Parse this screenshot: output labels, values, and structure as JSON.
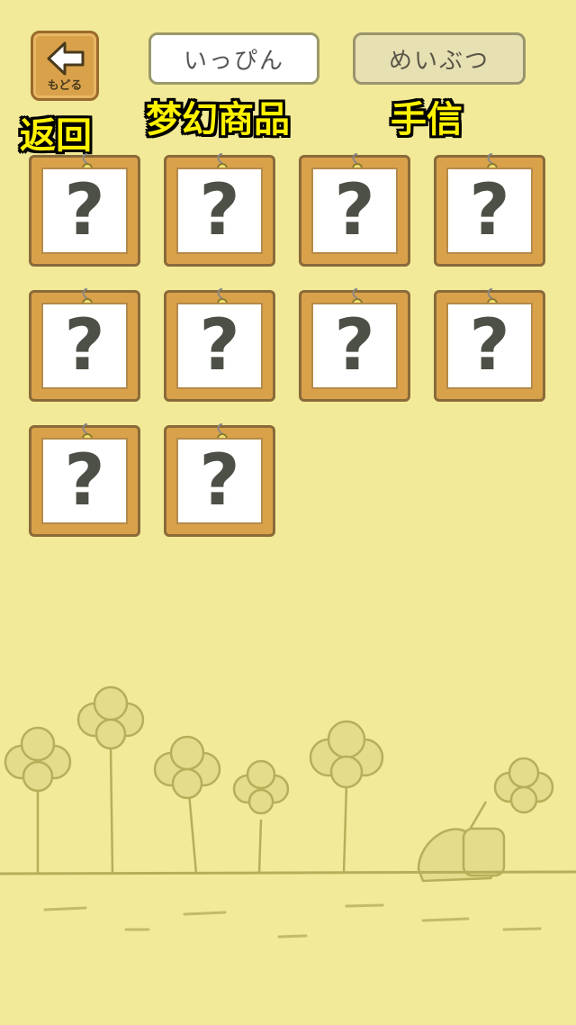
{
  "header": {
    "back_label": "もどる",
    "tabs": [
      {
        "label": "いっぴん",
        "active": true
      },
      {
        "label": "めいぶつ",
        "active": false
      }
    ]
  },
  "captions": {
    "back": "返回",
    "items": "梦幻商品",
    "gifts": "手信"
  },
  "grid": {
    "cards": [
      {
        "symbol": "?"
      },
      {
        "symbol": "?"
      },
      {
        "symbol": "?"
      },
      {
        "symbol": "?"
      },
      {
        "symbol": "?"
      },
      {
        "symbol": "?"
      },
      {
        "symbol": "?"
      },
      {
        "symbol": "?"
      },
      {
        "symbol": "?"
      },
      {
        "symbol": "?"
      }
    ]
  },
  "colors": {
    "background": "#f2ea98",
    "card_frame": "#d9a24a",
    "caption_text": "#fff200",
    "clover": "#e4dc8a"
  },
  "icons": {
    "back": "left-arrow-icon",
    "pin": "pin-icon",
    "scene": "clover-field-with-frog-illustration"
  }
}
